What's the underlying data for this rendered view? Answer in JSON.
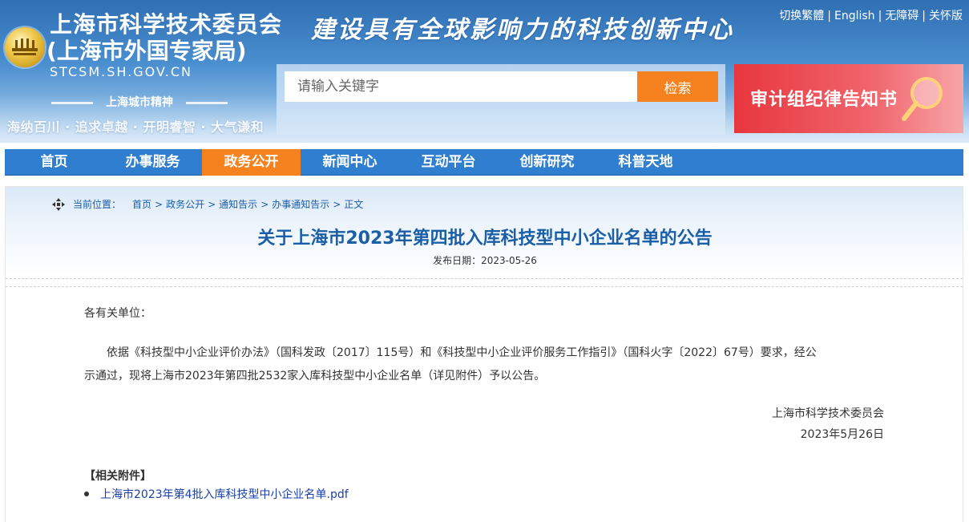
{
  "header": {
    "org_name": "上海市科学技术委员会",
    "org_sub": "(上海市外国专家局)",
    "domain": "STCSM.SH.GOV.CN",
    "slogan": "建设具有全球影响力的科技创新中心",
    "spirit_title": "上海城市精神",
    "spirit_text": "海纳百川 · 追求卓越 · 开明睿智 · 大气谦和",
    "top_links": [
      "切换繁體",
      "English",
      "无障碍",
      "关怀版"
    ],
    "search_placeholder": "请输入关键字",
    "search_button": "检索",
    "ad_banner": "审计组纪律告知书"
  },
  "nav": {
    "items": [
      "首页",
      "办事服务",
      "政务公开",
      "新闻中心",
      "互动平台",
      "创新研究",
      "科普天地"
    ],
    "active": "政务公开"
  },
  "breadcrumb": {
    "label": "当前位置：",
    "items": [
      "首页",
      "政务公开",
      "通知告示",
      "办事通知告示",
      "正文"
    ]
  },
  "article": {
    "title": "关于上海市2023年第四批入库科技型中小企业名单的公告",
    "date": "发布日期：2023-05-26",
    "salutation": "各有关单位：",
    "body_line1": "依据《科技型中小企业评价办法》（国科发政〔2017〕115号）和《科技型中小企业评价服务工作指引》（国科火字〔2022〕67号）要求，经公",
    "body_line2": "示通过，现将上海市2023年第四批2532家入库科技型中小企业名单（详见附件）予以公告。",
    "signature_org": "上海市科学技术委员会",
    "signature_date": "2023年5月26日",
    "attachments_heading": "【相关附件】",
    "attachments": [
      "上海市2023年第4批入库科技型中小企业名单.pdf"
    ]
  },
  "colors": {
    "nav_bg": "#2f7ed0",
    "nav_active": "#f5821f",
    "title_blue": "#1a5ea8",
    "search_button": "#f5821f",
    "banner_red": "#e8363e"
  }
}
